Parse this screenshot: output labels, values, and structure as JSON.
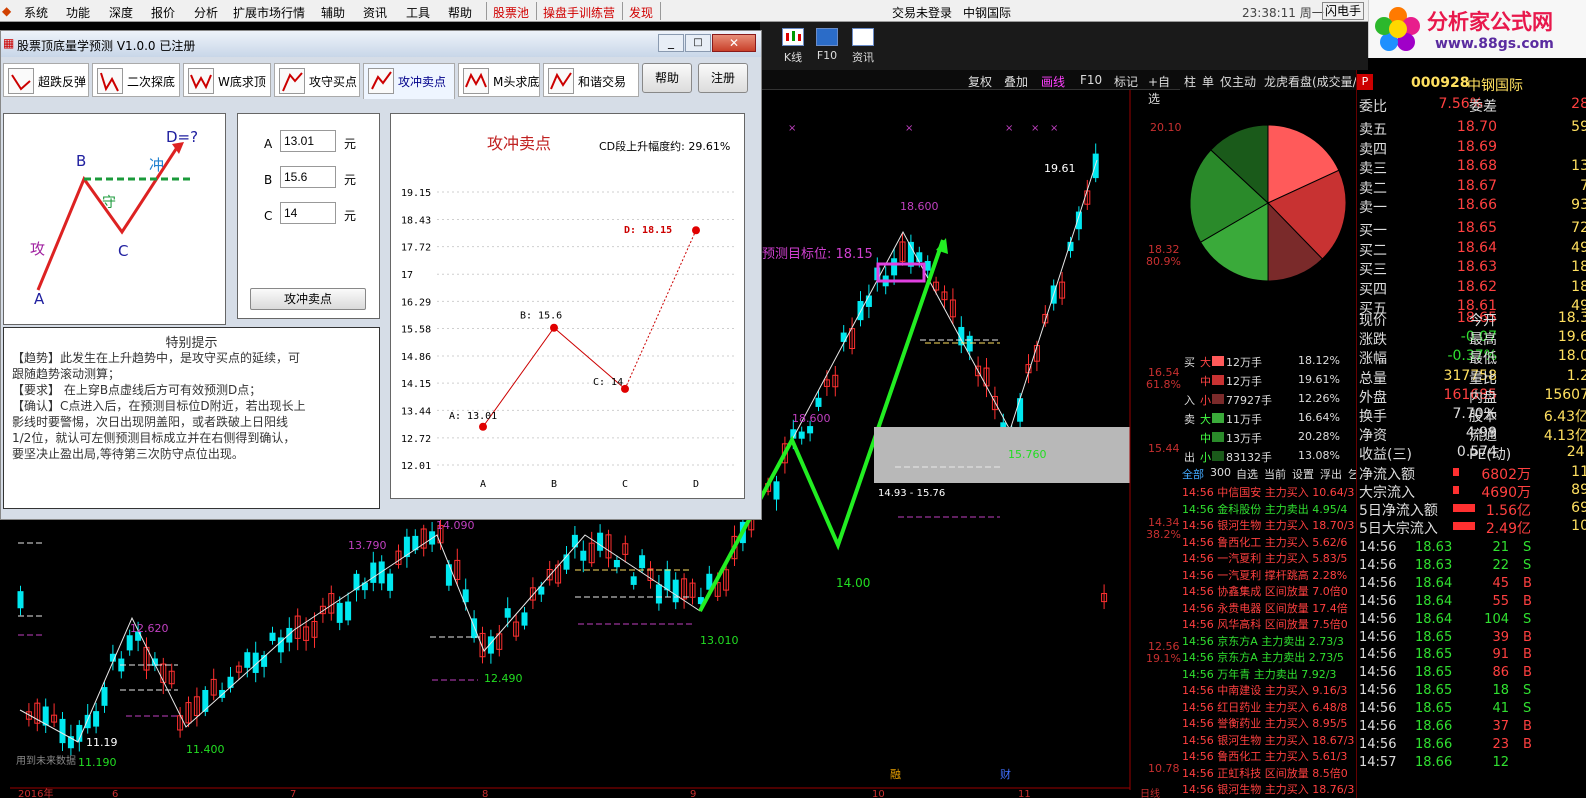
{
  "menu": {
    "items": [
      "系统",
      "功能",
      "深度",
      "报价",
      "分析",
      "扩展市场行情",
      "辅助",
      "资讯",
      "工具",
      "帮助"
    ],
    "highlights": [
      "股票池",
      "操盘手训练营",
      "发现"
    ],
    "login_status": "交易未登录",
    "stock_title": "中钢国际",
    "time": "23:38:11 周一",
    "flash": "闪电手"
  },
  "logo": {
    "title": "分析家公式网",
    "url": "www.88gs.com"
  },
  "toolbar": {
    "buttons": [
      "K线",
      "F10",
      "资讯"
    ]
  },
  "chart_header": {
    "items": [
      "复权",
      "叠加",
      "画线",
      "F10",
      "标记",
      "+自选"
    ]
  },
  "dialog": {
    "title": "股票顶底量学预测 V1.0.0  已注册",
    "tabs": [
      "超跌反弹",
      "二次探底",
      "W底求顶",
      "攻守买点",
      "攻冲卖点",
      "M头求底",
      "和谐交易"
    ],
    "help": "帮助",
    "register": "注册",
    "diagram": {
      "d": "D=?",
      "b": "B",
      "c": "C",
      "a": "A",
      "chong": "冲",
      "shou": "守",
      "gong": "攻"
    },
    "inputs": [
      {
        "label": "A",
        "value": "13.01",
        "unit": "元"
      },
      {
        "label": "B",
        "value": "15.6",
        "unit": "元"
      },
      {
        "label": "C",
        "value": "14",
        "unit": "元"
      }
    ],
    "calc_button": "攻冲卖点",
    "tips_title": "特别提示",
    "tips": [
      "【趋势】此发生在上升趋势中，是攻守买点的延续，可",
      "跟随趋势滚动测算；",
      "【要求】  在上穿B点虚线后方可有效预测D点；",
      "【确认】C点进入后，在预测目标位D附近，若出现长上",
      "影线时要警惕，次日出现阴盖阳，或者跌破上日阳线",
      "1/2位，就认可左侧预测目标成立并在右侧得到确认，",
      "要坚决止盈出局,等待第三次防守点位出现。"
    ],
    "chart": {
      "title": "攻冲卖点",
      "subtitle": "CD段上升幅度约: 29.61%",
      "yticks": [
        "19.15",
        "18.43",
        "17.72",
        "17",
        "16.29",
        "15.58",
        "14.86",
        "14.15",
        "13.44",
        "12.72",
        "12.01"
      ],
      "points": [
        {
          "x": "A",
          "label": "A: 13.01"
        },
        {
          "x": "B",
          "label": "B: 15.6"
        },
        {
          "x": "C",
          "label": "C: 14"
        },
        {
          "x": "D",
          "label": "D: 18.15"
        }
      ]
    }
  },
  "chart_data": {
    "type": "line",
    "title": "攻冲卖点",
    "categories": [
      "A",
      "B",
      "C",
      "D"
    ],
    "values": [
      13.01,
      15.6,
      14,
      18.15
    ],
    "ylim": [
      12.01,
      19.15
    ]
  },
  "kline": {
    "price_labels": [
      "20.10",
      "18.32",
      "80.9%",
      "16.54",
      "61.8%",
      "15.44",
      "14.34",
      "38.2%",
      "12.56",
      "19.1%",
      "10.78"
    ],
    "annotations": [
      "19.61",
      "18.600",
      "预测目标位:  18.15",
      "18.600",
      "14.93 - 15.76",
      "14.00",
      "15.760",
      "13.790",
      "14.090",
      "13.010",
      "12.620",
      "12.490",
      "11.19",
      "11.400",
      "11.190",
      "用到未来数据"
    ],
    "xaxis": [
      "2016年",
      "6",
      "7",
      "8",
      "9",
      "10",
      "11",
      "日线"
    ],
    "markers": [
      "融",
      "财"
    ]
  },
  "quote": {
    "code": "000928",
    "name": "中钢国际",
    "book": [
      {
        "k": "委比",
        "v": "7.56%",
        "k2": "委差",
        "v2": "28"
      },
      {
        "k": "卖五",
        "v": "18.70",
        "v2": "59"
      },
      {
        "k": "卖四",
        "v": "18.69",
        "v2": ""
      },
      {
        "k": "卖三",
        "v": "18.68",
        "v2": "13"
      },
      {
        "k": "卖二",
        "v": "18.67",
        "v2": "7"
      },
      {
        "k": "卖一",
        "v": "18.66",
        "v2": "93"
      },
      {
        "k": "买一",
        "v": "18.65",
        "v2": "72"
      },
      {
        "k": "买二",
        "v": "18.64",
        "v2": "49"
      },
      {
        "k": "买三",
        "v": "18.63",
        "v2": "18"
      },
      {
        "k": "买四",
        "v": "18.62",
        "v2": "18"
      },
      {
        "k": "买五",
        "v": "18.61",
        "v2": "49"
      }
    ],
    "stats": [
      {
        "k": "现价",
        "v": "18.65",
        "k2": "今开",
        "v2": "18.3"
      },
      {
        "k": "涨跌",
        "v": "-0.07",
        "k2": "最高",
        "v2": "19.6"
      },
      {
        "k": "涨幅",
        "v": "-0.37%",
        "k2": "最低",
        "v2": "18.0"
      },
      {
        "k": "总量",
        "v": "317758",
        "k2": "量比",
        "v2": "1.2"
      },
      {
        "k": "外盘",
        "v": "161685",
        "k2": "内盘",
        "v2": "15607"
      },
      {
        "k": "换手",
        "v": "7.70%",
        "k2": "股本",
        "v2": "6.43亿"
      },
      {
        "k": "净资",
        "v": "4.99",
        "k2": "流通",
        "v2": "4.13亿"
      },
      {
        "k": "收益(三)",
        "v": "0.574",
        "k2": "PE(动)",
        "v2": "24."
      }
    ],
    "flows": [
      {
        "k": "净流入额",
        "v": "6802万",
        "v2": "11"
      },
      {
        "k": "大宗流入",
        "v": "4690万",
        "v2": "89"
      },
      {
        "k": "5日净流入额",
        "v": "1.56亿",
        "v2": "69"
      },
      {
        "k": "5日大宗流入",
        "v": "2.49亿",
        "v2": "10"
      }
    ],
    "ticks": [
      {
        "t": "14:56",
        "p": "18.63",
        "v": "21",
        "d": "S"
      },
      {
        "t": "14:56",
        "p": "18.63",
        "v": "22",
        "d": "S"
      },
      {
        "t": "14:56",
        "p": "18.64",
        "v": "45",
        "d": "B"
      },
      {
        "t": "14:56",
        "p": "18.64",
        "v": "55",
        "d": "B"
      },
      {
        "t": "14:56",
        "p": "18.64",
        "v": "104",
        "d": "S"
      },
      {
        "t": "14:56",
        "p": "18.65",
        "v": "39",
        "d": "B"
      },
      {
        "t": "14:56",
        "p": "18.65",
        "v": "91",
        "d": "B"
      },
      {
        "t": "14:56",
        "p": "18.65",
        "v": "86",
        "d": "B"
      },
      {
        "t": "14:56",
        "p": "18.65",
        "v": "18",
        "d": "S"
      },
      {
        "t": "14:56",
        "p": "18.65",
        "v": "41",
        "d": "S"
      },
      {
        "t": "14:56",
        "p": "18.66",
        "v": "37",
        "d": "B"
      },
      {
        "t": "14:56",
        "p": "18.66",
        "v": "23",
        "d": "B"
      },
      {
        "t": "14:57",
        "p": "18.66",
        "v": "12",
        "d": ""
      }
    ]
  },
  "fund": {
    "header": [
      "柱",
      "单",
      "仅主动",
      "龙虎看盘(成交量/技"
    ],
    "rows": [
      {
        "side": "买",
        "size": "大",
        "hands": "12万手",
        "pct": "18.12%"
      },
      {
        "side": "",
        "size": "中",
        "hands": "12万手",
        "pct": "19.61%"
      },
      {
        "side": "入",
        "size": "小",
        "hands": "77927手",
        "pct": "12.26%"
      },
      {
        "side": "卖",
        "size": "大",
        "hands": "11万手",
        "pct": "16.64%"
      },
      {
        "side": "",
        "size": "中",
        "hands": "13万手",
        "pct": "20.28%"
      },
      {
        "side": "出",
        "size": "小",
        "hands": "83132手",
        "pct": "13.08%"
      }
    ]
  },
  "news": {
    "tabs": [
      "全部",
      "300",
      "自选",
      "当前",
      "设置",
      "浮出",
      "乞"
    ],
    "items": [
      {
        "t": "14:56",
        "n": "中信国安",
        "d": "主力买入 10.64/3"
      },
      {
        "t": "14:56",
        "n": "金科股份",
        "d": "主力卖出 4.95/4"
      },
      {
        "t": "14:56",
        "n": "银河生物",
        "d": "主力买入 18.70/3"
      },
      {
        "t": "14:56",
        "n": "鲁西化工",
        "d": "主力买入 5.62/6"
      },
      {
        "t": "14:56",
        "n": "一汽夏利",
        "d": "主力买入 5.83/5"
      },
      {
        "t": "14:56",
        "n": "一汽夏利",
        "d": "撑杆跳高 2.28%"
      },
      {
        "t": "14:56",
        "n": "协鑫集成",
        "d": "区间放量 7.0倍0"
      },
      {
        "t": "14:56",
        "n": "永贵电器",
        "d": "区间放量 17.4倍"
      },
      {
        "t": "14:56",
        "n": "风华高科",
        "d": "区间放量 7.5倍0"
      },
      {
        "t": "14:56",
        "n": "京东方A",
        "d": "主力卖出 2.73/3"
      },
      {
        "t": "14:56",
        "n": "京东方A",
        "d": "主力卖出 2.73/5"
      },
      {
        "t": "14:56",
        "n": "万年青",
        "d": "主力卖出 7.92/3"
      },
      {
        "t": "14:56",
        "n": "中南建设",
        "d": "主力买入 9.16/3"
      },
      {
        "t": "14:56",
        "n": "红日药业",
        "d": "主力买入 6.48/8"
      },
      {
        "t": "14:56",
        "n": "誉衡药业",
        "d": "主力买入 8.95/5"
      },
      {
        "t": "14:56",
        "n": "银河生物",
        "d": "主力买入 18.67/3"
      },
      {
        "t": "14:56",
        "n": "鲁西化工",
        "d": "主力买入 5.61/3"
      },
      {
        "t": "14:56",
        "n": "正虹科技",
        "d": "区间放量 8.5倍0"
      },
      {
        "t": "14:56",
        "n": "银河生物",
        "d": "主力买入 18.76/3"
      }
    ]
  }
}
